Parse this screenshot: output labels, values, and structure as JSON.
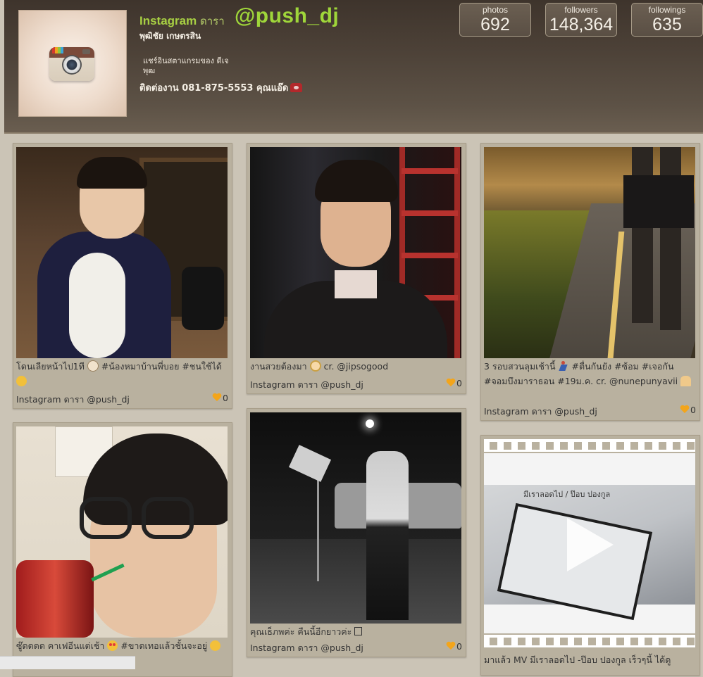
{
  "profile": {
    "brand_bold": "Instagram",
    "brand_sub": "ดารา",
    "username": "@push_dj",
    "full_name": "พุฒิชัย เกษตรสิน",
    "bio": "แชร์อินสตาแกรมของ ดีเจพุฒ",
    "contact": "ติดต่องาน 081-875-5553 คุณแอ๊ด"
  },
  "stats": [
    {
      "label": "photos",
      "value": "692"
    },
    {
      "label": "followers",
      "value": "148,364"
    },
    {
      "label": "followings",
      "value": "635"
    }
  ],
  "posts": [
    {
      "caption": "โดนเลียหน้าไป1ที",
      "caption_tail": "#น้องหมาบ้านพี่บอย #ชนใช้ได้",
      "by": "Instagram ดารา @push_dj",
      "likes": "0"
    },
    {
      "caption": "งานสวยต้องมา",
      "caption_tail": "cr. @jipsogood",
      "by": "Instagram ดารา @push_dj",
      "likes": "0"
    },
    {
      "caption": "3 รอบสวนลุมเช้านี้",
      "caption_tail": "#ตื่นกันยัง #ซ้อม #เจอกัน #จอมบึงมาราธอน #19ม.ค. cr. @nunepunyavii",
      "by": "Instagram ดารา @push_dj",
      "likes": "0"
    },
    {
      "caption": "ซู๊ดดดด คาเฟอีนแต่เช้า",
      "caption_tail": "#ขาดเทอแล้วชั้นจะอยู่"
    },
    {
      "caption": "คุณเธ็ภพค่ะ คืนนี้อีกยาวค่ะ",
      "by": "Instagram ดารา @push_dj",
      "likes": "0"
    },
    {
      "caption": "มาแล้ว MV มีเราลอดไป -ป๊อบ ปองกูล เร็วๆนี้ ได้ดู",
      "overlay": "มีเราลอดไป / ป๊อบ ปองกูล"
    }
  ]
}
